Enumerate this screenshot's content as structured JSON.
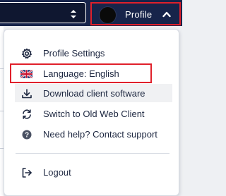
{
  "topbar": {
    "profile_label": "Profile"
  },
  "menu": {
    "items": [
      {
        "label": "Profile Settings",
        "icon": "gear-icon"
      },
      {
        "label": "Language: English",
        "icon": "uk-flag-icon"
      },
      {
        "label": "Download client software",
        "icon": "download-icon"
      },
      {
        "label": "Switch to Old Web Client",
        "icon": "switch-icon"
      },
      {
        "label": "Need help? Contact support",
        "icon": "help-icon"
      },
      {
        "label": "Logout",
        "icon": "logout-icon"
      }
    ]
  },
  "colors": {
    "topbar_bg": "#17244a",
    "highlight_border": "#e0202b",
    "text": "#1d2740"
  }
}
